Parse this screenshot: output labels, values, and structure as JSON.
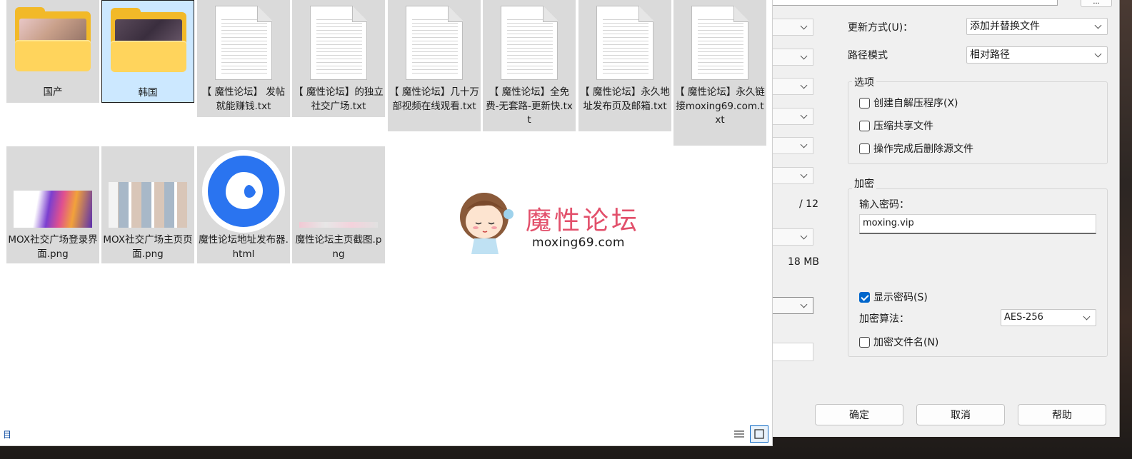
{
  "dialog": {
    "update_mode_label": "更新方式(U)：",
    "update_mode_value": "添加并替换文件",
    "path_mode_label": "路径模式",
    "path_mode_value": "相对路径",
    "options_title": "选项",
    "opt_sfx": "创建自解压程序(X)",
    "opt_shared": "压缩共享文件",
    "opt_delete": "操作完成后删除源文件",
    "encrypt_title": "加密",
    "password_label": "输入密码：",
    "password_value": "moxing.vip",
    "show_password": "显示密码(S)",
    "algo_label": "加密算法：",
    "algo_value": "AES-256",
    "encrypt_names": "加密文件名(N)",
    "partial_threads": "/ 12",
    "partial_memory": "18 MB",
    "ok": "确定",
    "cancel": "取消",
    "help": "帮助",
    "more_button": "..."
  },
  "explorer": {
    "items": [
      {
        "name": "国产",
        "type": "folder"
      },
      {
        "name": "韩国",
        "type": "folder",
        "selected": true
      },
      {
        "name": "【 魔性论坛】 发帖就能赚钱.txt",
        "type": "txt"
      },
      {
        "name": "【 魔性论坛】的独立社交广场.txt",
        "type": "txt"
      },
      {
        "name": "【 魔性论坛】几十万部视频在线观看.txt",
        "type": "txt"
      },
      {
        "name": "【 魔性论坛】全免费-无套路-更新快.txt",
        "type": "txt"
      },
      {
        "name": "【 魔性论坛】永久地址发布页及邮箱.txt",
        "type": "txt"
      },
      {
        "name": "【 魔性论坛】永久链接moxing69.com.txt",
        "type": "txt"
      },
      {
        "name": "MOX社交广场登录界面.png",
        "type": "png"
      },
      {
        "name": "MOX社交广场主页页面.png",
        "type": "png"
      },
      {
        "name": "魔性论坛地址发布器.html",
        "type": "html"
      },
      {
        "name": "魔性论坛主页截图.png",
        "type": "png"
      }
    ],
    "status_text": "目",
    "view_icons": [
      "details-view-icon",
      "large-icons-view-icon"
    ]
  },
  "watermark": {
    "title": "魔性论坛",
    "url": "moxing69.com"
  },
  "colors": {
    "folder": "#f2b928",
    "selection": "#cce8ff",
    "accent": "#0066cc",
    "watermark": "#e2506b"
  }
}
